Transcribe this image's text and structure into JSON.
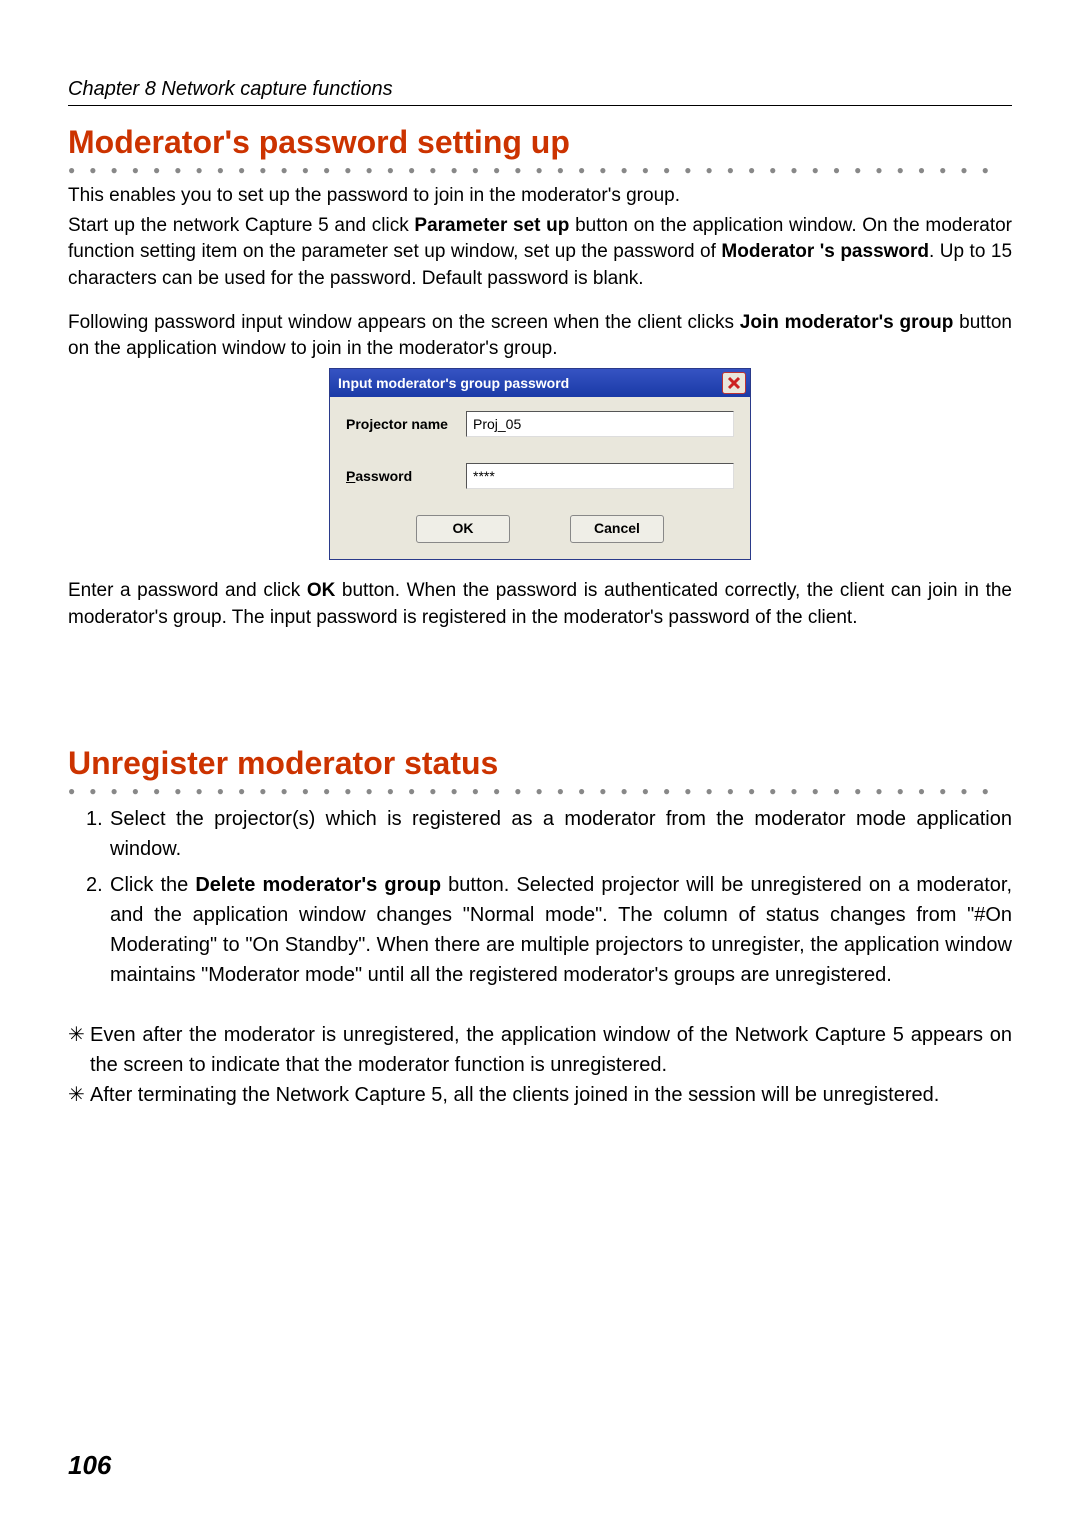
{
  "header": {
    "chapter": "Chapter 8 Network capture functions"
  },
  "section1": {
    "title": "Moderator's password setting up",
    "p1": "This enables you to set up the password to join in the moderator's group.",
    "p2a": "Start up the network Capture 5 and click ",
    "p2b_bold": "Parameter set up",
    "p2c": " button on the application window. On the moderator function setting item on the parameter set up window, set up the password of ",
    "p2d_bold": "Moderator 's password",
    "p2e": ". Up to 15 characters can be used for the password. Default  password is blank.",
    "p3a": "Following password input window appears on the screen when the client clicks ",
    "p3b_bold": "Join moderator's group",
    "p3c": " button on the application window to join in the moderator's group.",
    "p4a": "Enter a password and click ",
    "p4b_bold": "OK",
    "p4c": " button. When the password is authenticated correctly, the client can join in the moderator's group. The input password is registered in the moderator's password of the client."
  },
  "dialog": {
    "title": "Input moderator's group password",
    "label_projector": "Projector name",
    "value_projector": "Proj_05",
    "label_password_pre": "P",
    "label_password_rest": "assword",
    "value_password": "****",
    "ok": "OK",
    "cancel": "Cancel"
  },
  "section2": {
    "title": "Unregister moderator status",
    "li1": "Select the projector(s) which is registered as a moderator from the moderator mode application window.",
    "li2a": "Click the ",
    "li2b_bold": "Delete moderator's group",
    "li2c": " button. Selected projector will be unregistered on a moderator, and the application window changes \"Normal mode\".  The column of status changes from \"#On Moderating\" to \"On Standby\". When there are multiple projectors to unregister, the application window maintains \"Moderator mode\" until all the registered moderator's groups are unregistered.",
    "note1": "Even after the moderator is unregistered, the application window of the Network Capture 5 appears on the screen to indicate that the moderator function is unregistered.",
    "note2": "After terminating the Network Capture 5, all the clients joined in the session will be unregistered."
  },
  "page_number": "106",
  "dots": "●●●●●●●●●●●●●●●●●●●●●●●●●●●●●●●●●●●●●●●●●●●●"
}
